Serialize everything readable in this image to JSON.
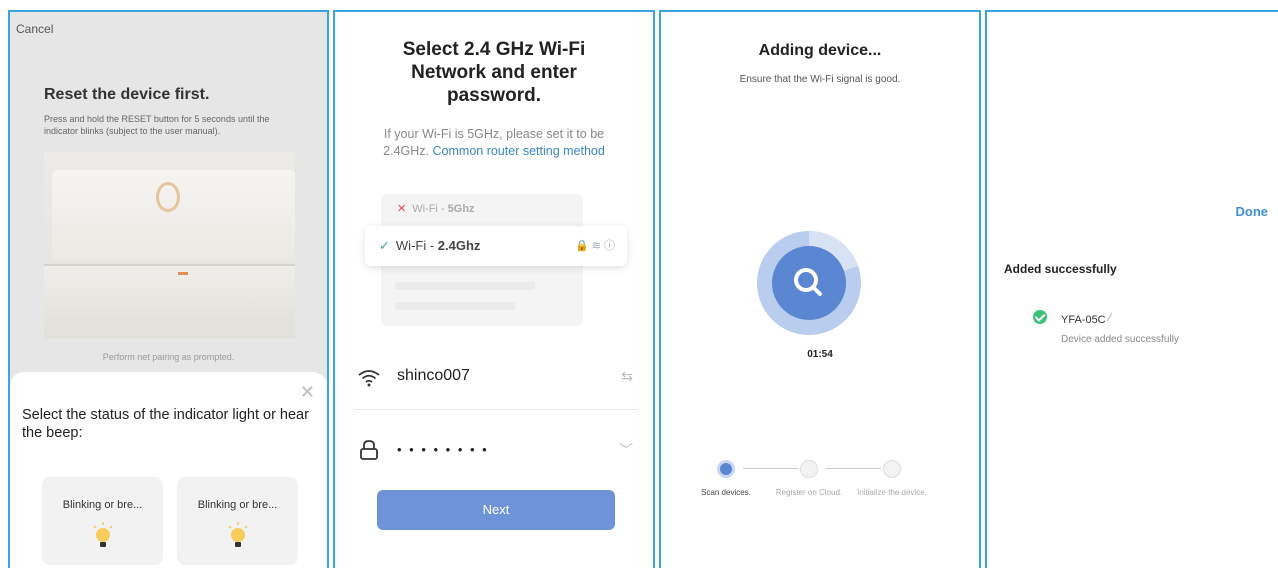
{
  "screen1": {
    "cancel_label": "Cancel",
    "title": "Reset the device first.",
    "description": "Press and hold the RESET button for 5 seconds until the indicator blinks (subject to the user manual).",
    "prompt": "Perform net pairing as prompted.",
    "sheet_question": "Select the status of the indicator light or hear the beep:",
    "options": [
      {
        "label": "Blinking or bre..."
      },
      {
        "label": "Blinking or bre..."
      }
    ]
  },
  "screen2": {
    "title": "Select 2.4 GHz Wi-Fi Network and enter password.",
    "info": "If your Wi-Fi is 5GHz, please set it to be 2.4GHz.",
    "link": "Common router setting method",
    "wifi_bad": {
      "prefix": "Wi-Fi - ",
      "band": "5Ghz"
    },
    "wifi_good": {
      "prefix": "Wi-Fi - ",
      "band": "2.4Ghz"
    },
    "ssid": "shinco007",
    "password_mask": "• • • • • • • •",
    "next_label": "Next"
  },
  "screen3": {
    "title": "Adding device...",
    "subtitle": "Ensure that the Wi-Fi signal is good.",
    "timer": "01:54",
    "steps": [
      {
        "label": "Scan devices.",
        "state": "active"
      },
      {
        "label": "Register on Cloud.",
        "state": "pending"
      },
      {
        "label": "Initialize the device.",
        "state": "pending"
      }
    ],
    "accent": "#4f79c9"
  },
  "screen4": {
    "done_label": "Done",
    "added_title": "Added successfully",
    "device_name": "YFA-05C",
    "device_status": "Device added successfully"
  }
}
